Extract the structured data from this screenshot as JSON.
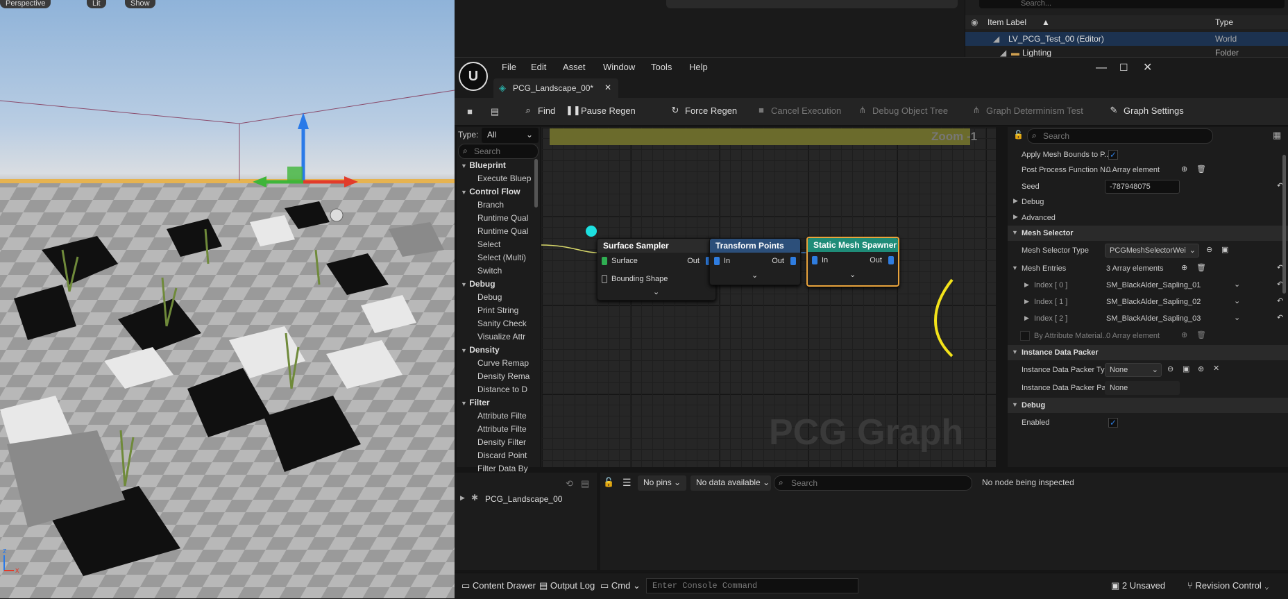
{
  "viewport": {
    "buttons": [
      "Perspective",
      "Lit",
      "Show"
    ],
    "gizmo_axis_z": "z",
    "gizmo_axis_x": "x"
  },
  "outliner": {
    "search_placeholder": "Search...",
    "col_item_label": "Item Label",
    "col_type": "Type",
    "rows": [
      {
        "label": "LV_PCG_Test_00 (Editor)",
        "type": "World"
      },
      {
        "label": "Lighting",
        "type": "Folder"
      }
    ]
  },
  "editor": {
    "menu": [
      "File",
      "Edit",
      "Asset",
      "Window",
      "Tools",
      "Help"
    ],
    "tab_title": "PCG_Landscape_00*",
    "toolbar": {
      "find": "Find",
      "pause_regen": "Pause Regen",
      "force_regen": "Force Regen",
      "cancel_execution": "Cancel Execution",
      "debug_object_tree": "Debug Object Tree",
      "graph_determinism_test": "Graph Determinism Test",
      "graph_settings": "Graph Settings"
    },
    "palette": {
      "type_label": "Type:",
      "type_value": "All",
      "search_placeholder": "Search",
      "categories": [
        {
          "name": "Blueprint",
          "items": [
            "Execute Bluep"
          ]
        },
        {
          "name": "Control Flow",
          "items": [
            "Branch",
            "Runtime Qual",
            "Runtime Qual",
            "Select",
            "Select (Multi)",
            "Switch"
          ]
        },
        {
          "name": "Debug",
          "items": [
            "Debug",
            "Print String",
            "Sanity Check",
            "Visualize Attr"
          ]
        },
        {
          "name": "Density",
          "items": [
            "Curve Remap",
            "Density Rema",
            "Distance to D"
          ]
        },
        {
          "name": "Filter",
          "items": [
            "Attribute Filte",
            "Attribute Filte",
            "Density Filter",
            "Discard Point",
            "Filter Data By"
          ]
        }
      ]
    },
    "graph": {
      "zoom": "Zoom -1",
      "watermark": "PCG Graph",
      "nodes": {
        "surface_sampler": {
          "title": "Surface Sampler",
          "in1": "Surface",
          "in2": "Bounding Shape",
          "out": "Out"
        },
        "transform_points": {
          "title": "Transform Points",
          "in": "In",
          "out": "Out"
        },
        "static_mesh_spawner": {
          "title": "Static Mesh Spawner",
          "in": "In",
          "out": "Out"
        }
      }
    },
    "details": {
      "search_placeholder": "Search",
      "apply_mesh_bounds": "Apply Mesh Bounds to P...",
      "post_process_fn": "Post Process Function N...",
      "post_process_value": "0 Array element",
      "seed_label": "Seed",
      "seed_value": "-787948075",
      "debug_collapsed": "Debug",
      "advanced": "Advanced",
      "mesh_selector_section": "Mesh Selector",
      "mesh_selector_type_label": "Mesh Selector Type",
      "mesh_selector_type_value": "PCGMeshSelectorWei",
      "mesh_entries_label": "Mesh Entries",
      "mesh_entries_value": "3 Array elements",
      "entries": [
        {
          "label": "Index [ 0 ]",
          "value": "SM_BlackAlder_Sapling_01"
        },
        {
          "label": "Index [ 1 ]",
          "value": "SM_BlackAlder_Sapling_02"
        },
        {
          "label": "Index [ 2 ]",
          "value": "SM_BlackAlder_Sapling_03"
        }
      ],
      "by_attribute_label": "By Attribute Material...",
      "by_attribute_value": "0 Array element",
      "instance_packer_section": "Instance Data Packer",
      "instance_packer_type_label": "Instance Data Packer Type",
      "instance_packer_type_value": "None",
      "instance_packer_params_label": "Instance Data Packer Pa...",
      "instance_packer_params_value": "None",
      "debug_section": "Debug",
      "enabled_label": "Enabled"
    },
    "bottom": {
      "tree_item": "PCG_Landscape_00",
      "pins_dropdown": "No pins",
      "data_dropdown": "No data available",
      "search_placeholder": "Search",
      "inspect_status": "No node being inspected"
    },
    "statusbar": {
      "content_drawer": "Content Drawer",
      "output_log": "Output Log",
      "cmd": "Cmd",
      "console_placeholder": "Enter Console Command",
      "unsaved": "2 Unsaved",
      "revision_control": "Revision Control"
    }
  },
  "colors": {
    "accent_blue": "#2f7de0",
    "node_selected_outline": "#e8a33c",
    "annotation_yellow": "#f2e21a",
    "spawner_header": "#1f8c78",
    "transform_header": "#2c4f7a",
    "sampler_header": "#2b2b2b"
  }
}
